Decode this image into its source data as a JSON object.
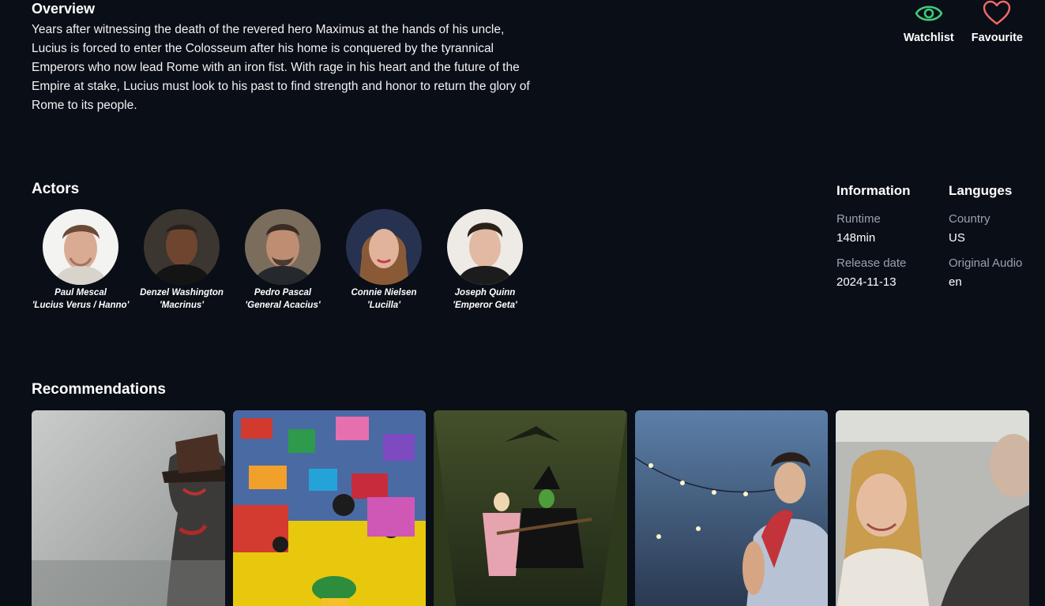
{
  "overview": {
    "title": "Overview",
    "text": "Years after witnessing the death of the revered hero Maximus at the hands of his uncle, Lucius is forced to enter the Colosseum after his home is conquered by the tyrannical Emperors who now lead Rome with an iron fist. With rage in his heart and the future of the Empire at stake, Lucius must look to his past to find strength and honor to return the glory of Rome to its people."
  },
  "actions": {
    "watchlist": {
      "label": "Watchlist",
      "icon": "eye-icon",
      "color": "#3fca7a"
    },
    "favourite": {
      "label": "Favourite",
      "icon": "heart-icon",
      "color": "#f06a6a"
    }
  },
  "actors": {
    "title": "Actors",
    "items": [
      {
        "name": "Paul Mescal",
        "role": "'Lucius Verus / Hanno'"
      },
      {
        "name": "Denzel Washington",
        "role": "'Macrinus'"
      },
      {
        "name": "Pedro Pascal",
        "role": "'General Acacius'"
      },
      {
        "name": "Connie Nielsen",
        "role": "'Lucilla'"
      },
      {
        "name": "Joseph Quinn",
        "role": "'Emperor Geta'"
      }
    ]
  },
  "information": {
    "title": "Information",
    "runtime_label": "Runtime",
    "runtime_value": "148min",
    "release_label": "Release date",
    "release_value": "2024-11-13"
  },
  "languages": {
    "title": "Languges",
    "country_label": "Country",
    "country_value": "US",
    "audio_label": "Original Audio",
    "audio_value": "en"
  },
  "recommendations": {
    "title": "Recommendations"
  },
  "colors": {
    "background": "#0a0e16",
    "text": "#ffffff",
    "muted": "#9aa2ad"
  }
}
